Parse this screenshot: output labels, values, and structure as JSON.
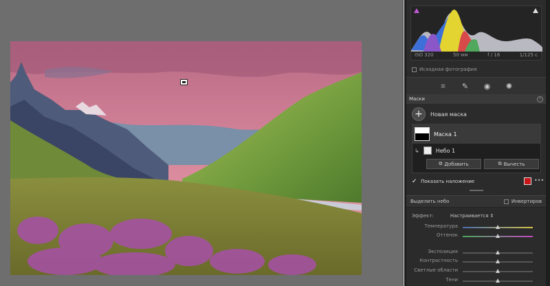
{
  "histogram": {
    "iso": "ISO 320",
    "focal": "50 мм",
    "aperture": "f / 16",
    "shutter": "1/125 с"
  },
  "original_photo_label": "Исходная фотография",
  "tools": [
    "crop-icon",
    "healing-icon",
    "red-eye-icon",
    "masking-icon"
  ],
  "masks_panel": {
    "title": "Маски",
    "new_mask": "Новая маска",
    "mask_name": "Маска 1",
    "component_name": "Небо 1",
    "add_label": "Добавить",
    "subtract_label": "Вычесть",
    "show_overlay": "Показать наложение",
    "overlay_color": "#c8161b"
  },
  "selection": {
    "title": "Выделить небо",
    "invert_label": "Инвертиров"
  },
  "effect": {
    "label": "Эффект:",
    "value": "Настраивается",
    "sliders": [
      {
        "label": "Температура",
        "value": 0.5
      },
      {
        "label": "Оттенок",
        "value": 0.5
      },
      {
        "label": "Экспозиция",
        "value": 0.5
      },
      {
        "label": "Контрастность",
        "value": 0.5
      },
      {
        "label": "Светлые области",
        "value": 0.5
      },
      {
        "label": "Тени",
        "value": 0.5
      }
    ]
  }
}
